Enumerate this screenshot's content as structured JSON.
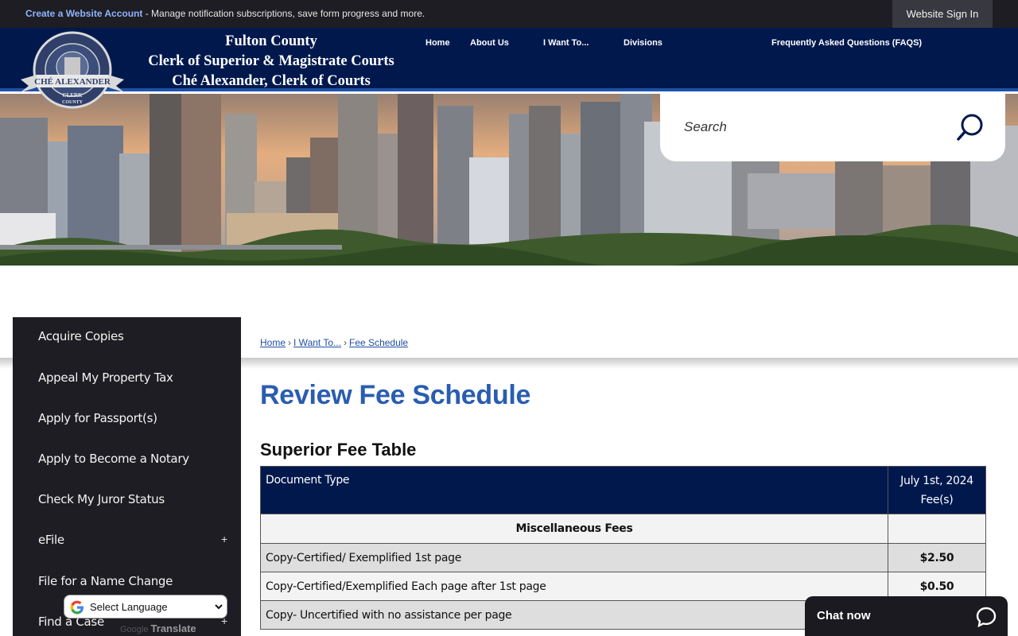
{
  "topbar": {
    "create_account_link": "Create a Website Account",
    "notice_text": " - Manage notification subscriptions, save form progress and more.",
    "signin_label": "Website Sign In"
  },
  "header": {
    "title_line1": "Fulton County",
    "title_line2": "Clerk of Superior & Magistrate Courts",
    "title_line3": "Ché Alexander, Clerk of Courts",
    "seal_text_top": "SUPERIOR & MAGISTRATE COURTS",
    "seal_banner": "CHÉ ALEXANDER",
    "seal_text_bottom": "CLERK",
    "seal_county": "COUNTY"
  },
  "nav": {
    "home": "Home",
    "about": "About Us",
    "iwant": "I Want To...",
    "divisions": "Divisions",
    "faq": "Frequently Asked Questions (FAQS)"
  },
  "search": {
    "placeholder": "Search"
  },
  "sidebar": {
    "items": [
      {
        "label": "Acquire Copies"
      },
      {
        "label": "Appeal My Property Tax"
      },
      {
        "label": "Apply for Passport(s)"
      },
      {
        "label": "Apply to Become a Notary"
      },
      {
        "label": "Check My Juror Status"
      },
      {
        "label": "eFile"
      },
      {
        "label": "File for a Name Change"
      },
      {
        "label": "Find a Case"
      }
    ],
    "expand_symbol": "+"
  },
  "translate": {
    "select_label": "Select Language",
    "powered_by": "Google",
    "translate_word": "Translate"
  },
  "breadcrumb": {
    "home": "Home",
    "iwant": "I Want To...",
    "current": "Fee Schedule",
    "separator": "›"
  },
  "page": {
    "title": "Review Fee Schedule",
    "section_title": "Superior Fee Table"
  },
  "fee_table": {
    "col_document": "Document Type",
    "col_fee_line1": "July 1st, 2024",
    "col_fee_line2": "Fee(s)",
    "group_misc": "Miscellaneous Fees",
    "rows": [
      {
        "doc": "Copy-Certified/ Exemplified 1st page",
        "fee": "$2.50"
      },
      {
        "doc": "Copy-Certified/Exemplified Each page after 1st page",
        "fee": "$0.50"
      },
      {
        "doc": "Copy- Uncertified with no assistance per page",
        "fee": ""
      }
    ]
  },
  "chat": {
    "label": "Chat now"
  },
  "colors": {
    "header_navy": "#00184c",
    "topbar_dark": "#1d1d23",
    "title_blue": "#2a5db0",
    "link_blue": "#1e4ea6"
  }
}
